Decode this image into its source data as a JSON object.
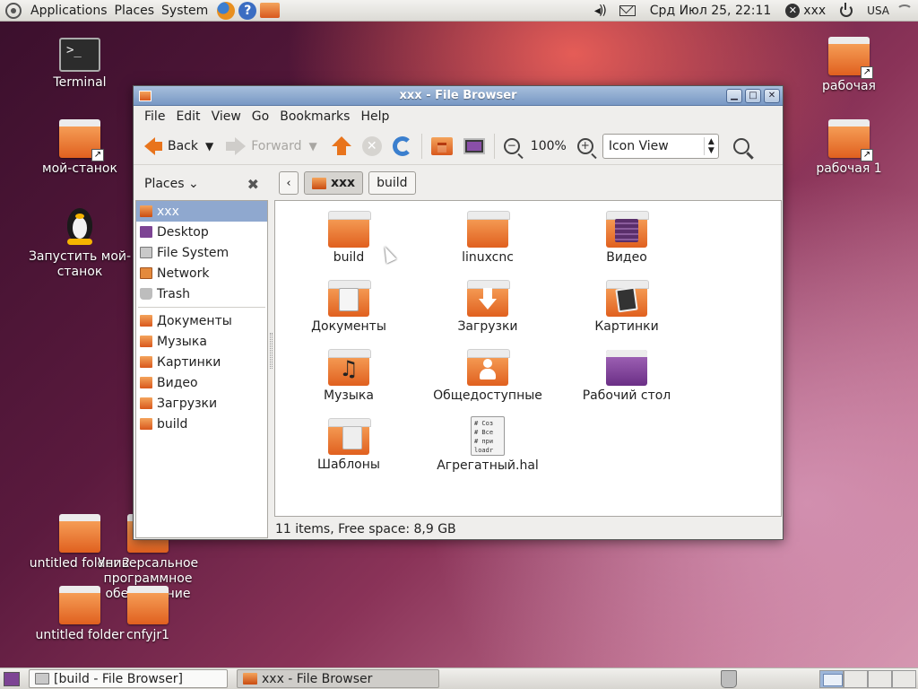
{
  "top_panel": {
    "menus": [
      "Applications",
      "Places",
      "System"
    ],
    "clock": "Срд Июл 25, 22:11",
    "user": "xxx",
    "keyboard_layout": "USA"
  },
  "desktop": {
    "icons_left": [
      {
        "label": "Terminal"
      },
      {
        "label": "мой-станок"
      },
      {
        "label": "Запустить мой-станок"
      },
      {
        "label": "untitled folder 2"
      },
      {
        "label": "Универсальное программное обеспечение СКИФ"
      },
      {
        "label": "untitled folder"
      },
      {
        "label": "cnfyjr1"
      }
    ],
    "icons_right": [
      {
        "label": "рабочая"
      },
      {
        "label": "рабочая 1"
      }
    ]
  },
  "window": {
    "title": "xxx - File Browser",
    "menubar": [
      "File",
      "Edit",
      "View",
      "Go",
      "Bookmarks",
      "Help"
    ],
    "toolbar": {
      "back": "Back",
      "forward": "Forward",
      "zoom": "100%",
      "view_mode": "Icon View"
    },
    "sidebar": {
      "header": "Places",
      "items": [
        "xxx",
        "Desktop",
        "File System",
        "Network",
        "Trash"
      ],
      "bookmarks": [
        "Документы",
        "Музыка",
        "Картинки",
        "Видео",
        "Загрузки",
        "build"
      ]
    },
    "pathbar": [
      "xxx",
      "build"
    ],
    "files": [
      {
        "name": "build"
      },
      {
        "name": "linuxcnc"
      },
      {
        "name": "Видео"
      },
      {
        "name": "Документы"
      },
      {
        "name": "Загрузки"
      },
      {
        "name": "Картинки"
      },
      {
        "name": "Музыка"
      },
      {
        "name": "Общедоступные"
      },
      {
        "name": "Рабочий стол"
      },
      {
        "name": "Шаблоны"
      },
      {
        "name": "Агрегатный.hal",
        "preview": [
          "# Соз",
          "# Все",
          "# при",
          "loadr"
        ]
      }
    ],
    "status": "11 items, Free space: 8,9 GB"
  },
  "taskbar": {
    "tasks": [
      {
        "label": "[build - File Browser]"
      },
      {
        "label": "xxx - File Browser"
      }
    ]
  }
}
